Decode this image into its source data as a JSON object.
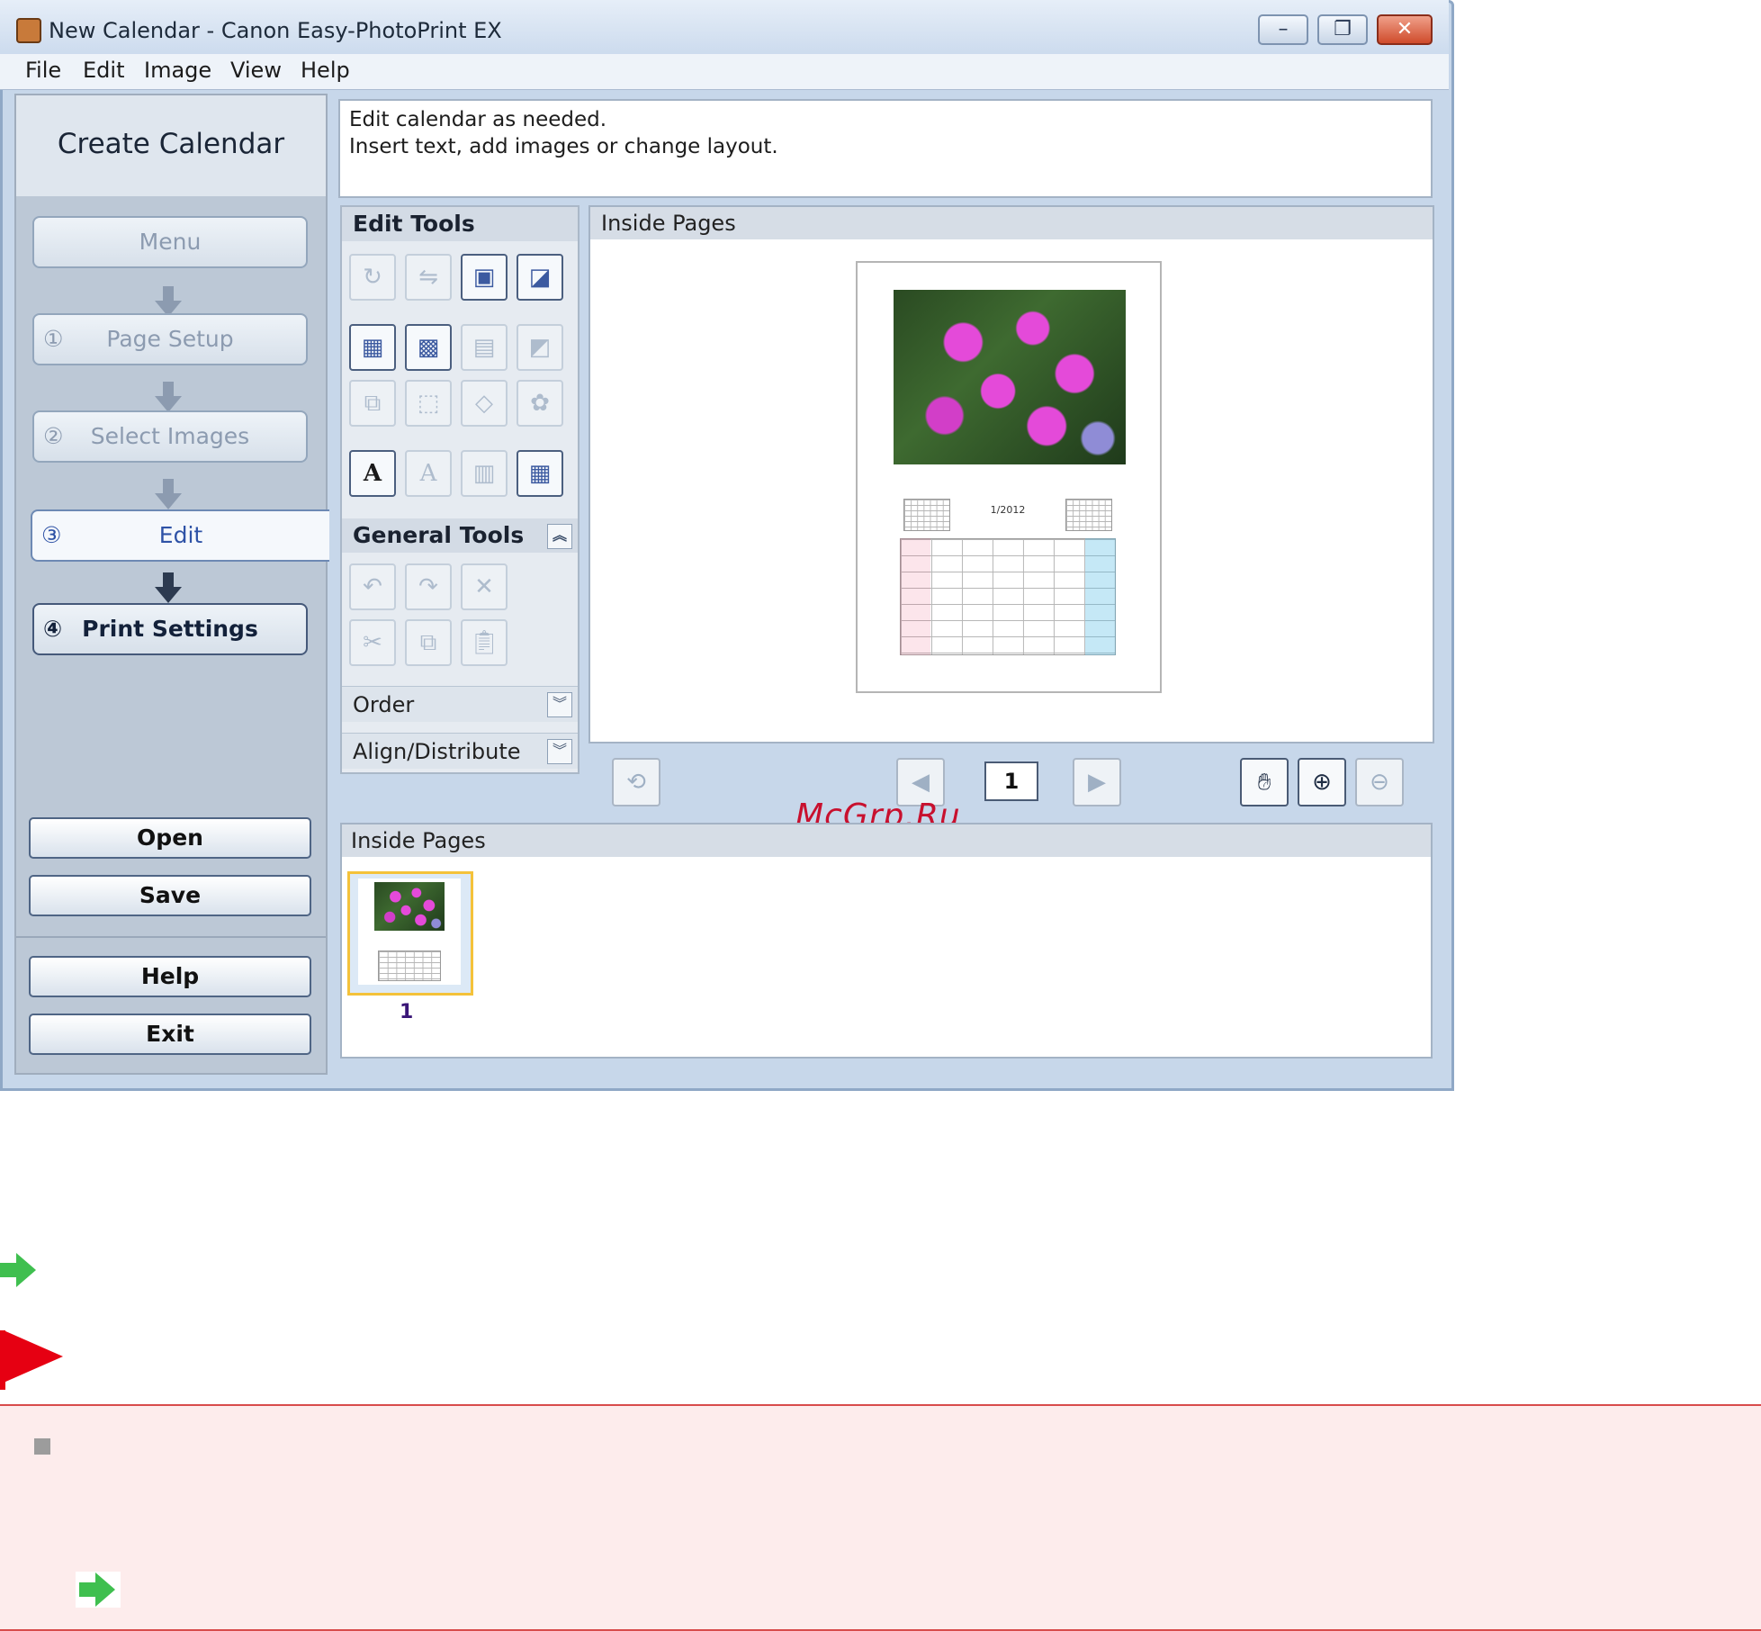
{
  "window": {
    "title": "New Calendar - Canon Easy-PhotoPrint EX",
    "controls": {
      "minimize": "–",
      "restore": "❐",
      "close": "✕"
    }
  },
  "menubar": {
    "items": [
      "File",
      "Edit",
      "Image",
      "View",
      "Help"
    ]
  },
  "nav": {
    "title": "Create Calendar",
    "steps": [
      {
        "num": "",
        "label": "Menu",
        "state": "disabled"
      },
      {
        "num": "①",
        "label": "Page Setup",
        "state": "disabled"
      },
      {
        "num": "②",
        "label": "Select Images",
        "state": "disabled"
      },
      {
        "num": "③",
        "label": "Edit",
        "state": "active"
      },
      {
        "num": "④",
        "label": "Print Settings",
        "state": "enabled"
      }
    ],
    "buttons": {
      "open": "Open",
      "save": "Save",
      "help": "Help",
      "exit": "Exit"
    }
  },
  "instructions": {
    "line1": "Edit calendar as needed.",
    "line2": "Insert text, add images or change layout."
  },
  "tools": {
    "edit_tools": "Edit Tools",
    "general_tools": "General Tools",
    "order": "Order",
    "align": "Align/Distribute"
  },
  "preview": {
    "header": "Inside Pages",
    "calendar_title": "1/2012",
    "page_number": "1"
  },
  "thumbnails": {
    "header": "Inside Pages",
    "items": [
      {
        "label": "1"
      }
    ]
  },
  "watermark": "McGrp.Ru",
  "colors": {
    "accent": "#2e52a6",
    "note_bg": "#fdecec",
    "note_border": "#d84b4b",
    "flag": "#e60012",
    "link_arrow": "#3fbf4f"
  }
}
